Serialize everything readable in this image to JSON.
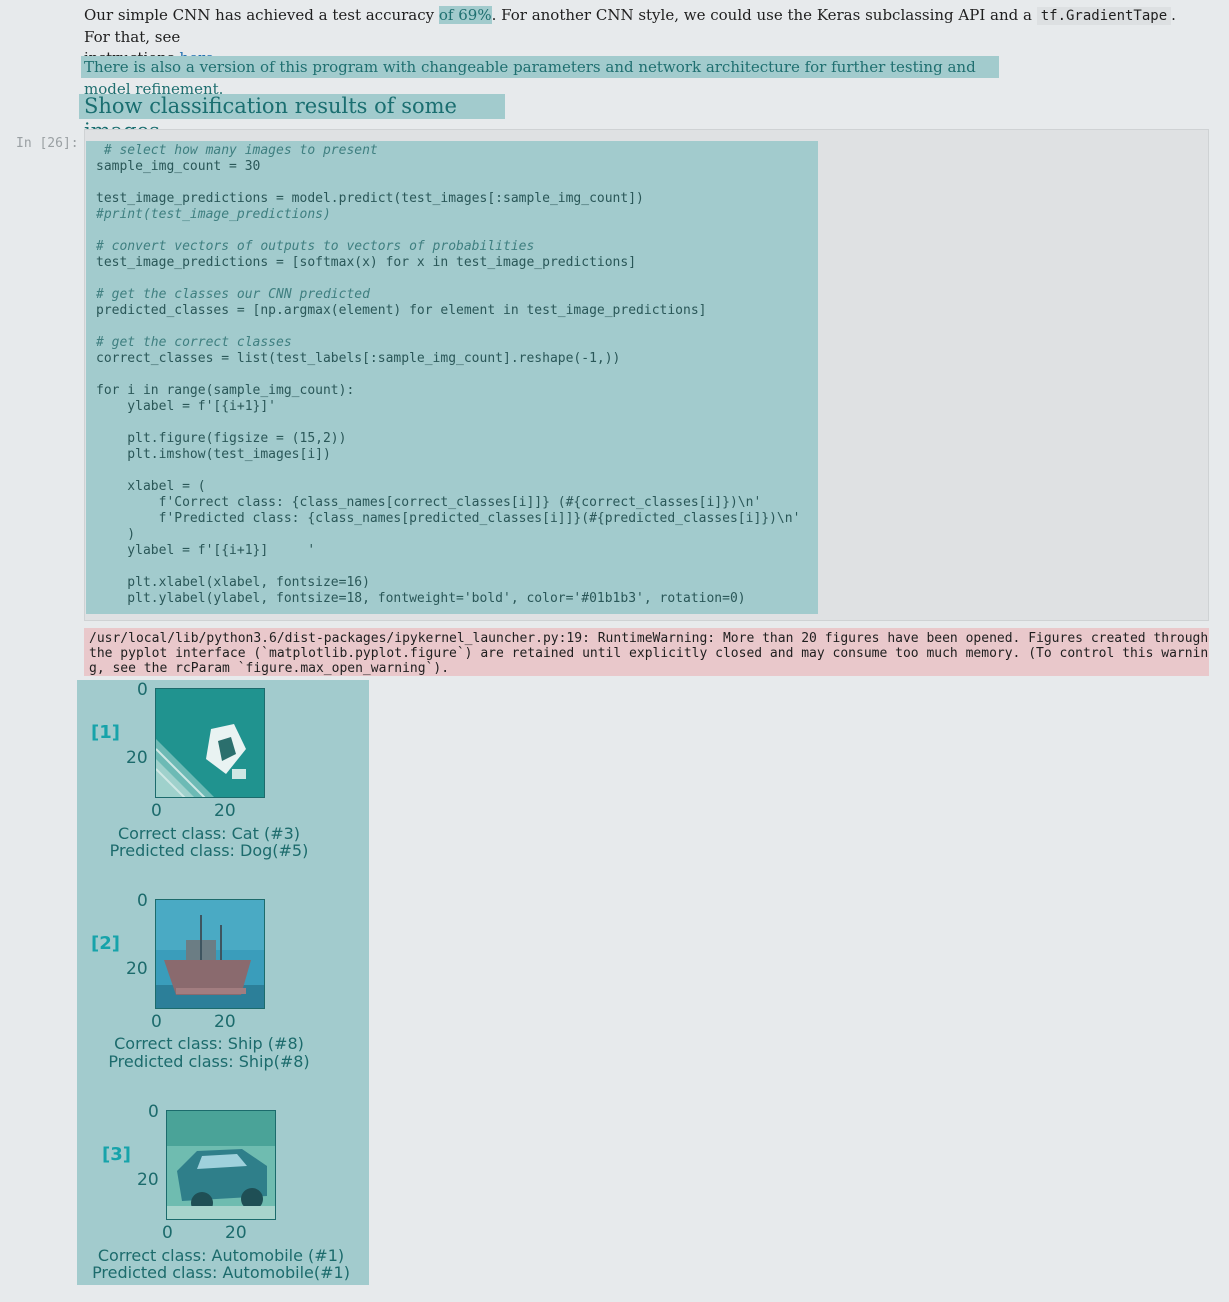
{
  "intro": {
    "text_before": "Our simple CNN has achieved a test accuracy ",
    "accuracy": "of 69%",
    "text_middle": ". For another CNN style, we could use the Keras subclassing API and a ",
    "code": "tf.GradientTape",
    "text_after": ". For that, see",
    "line2_before": "instructions ",
    "link": "here",
    "line2_after": "."
  },
  "note": "There is also a version of this program with changeable parameters and network architecture for further testing and model refinement.",
  "heading": "Show classification results of some images",
  "cell": {
    "prompt": "In [26]:",
    "code_lines": [
      " # select how many images to present",
      "sample_img_count = 30",
      "",
      "test_image_predictions = model.predict(test_images[:sample_img_count])",
      "#print(test_image_predictions)",
      "",
      "# convert vectors of outputs to vectors of probabilities",
      "test_image_predictions = [softmax(x) for x in test_image_predictions]",
      "",
      "# get the classes our CNN predicted",
      "predicted_classes = [np.argmax(element) for element in test_image_predictions]",
      "",
      "# get the correct classes",
      "correct_classes = list(test_labels[:sample_img_count].reshape(-1,))",
      "",
      "for i in range(sample_img_count):",
      "    ylabel = f'[{i+1}]'",
      "",
      "    plt.figure(figsize = (15,2))",
      "    plt.imshow(test_images[i])",
      "",
      "    xlabel = (",
      "        f'Correct class: {class_names[correct_classes[i]]} (#{correct_classes[i]})\\n'",
      "        f'Predicted class: {class_names[predicted_classes[i]]}(#{predicted_classes[i]})\\n'",
      "    )",
      "    ylabel = f'[{i+1}]     '",
      "",
      "    plt.xlabel(xlabel, fontsize=16)",
      "    plt.ylabel(ylabel, fontsize=18, fontweight='bold', color='#01b1b3', rotation=0)"
    ]
  },
  "stderr_lines": [
    "/usr/local/lib/python3.6/dist-packages/ipykernel_launcher.py:19: RuntimeWarning: More than 20 figures have been opened. Figures created through",
    "the pyplot interface (`matplotlib.pyplot.figure`) are retained until explicitly closed and may consume too much memory. (To control this warnin",
    "g, see the rcParam `figure.max_open_warning`)."
  ],
  "figures": [
    {
      "label": "[1]",
      "ytick0": "0",
      "ytick20": "20",
      "xtick0": "0",
      "xtick20": "20",
      "correct": "Correct class: Cat (#3)",
      "predicted": "Predicted class: Dog(#5)"
    },
    {
      "label": "[2]",
      "ytick0": "0",
      "ytick20": "20",
      "xtick0": "0",
      "xtick20": "20",
      "correct": "Correct class: Ship (#8)",
      "predicted": "Predicted class: Ship(#8)"
    },
    {
      "label": "[3]",
      "ytick0": "0",
      "ytick20": "20",
      "xtick0": "0",
      "xtick20": "20",
      "correct": "Correct class: Automobile (#1)",
      "predicted": "Predicted class: Automobile(#1)"
    }
  ],
  "colors": {
    "highlight": "#a2cbcd",
    "ylabel": "#01b1b3",
    "warning_bg": "#e9c8cb"
  }
}
